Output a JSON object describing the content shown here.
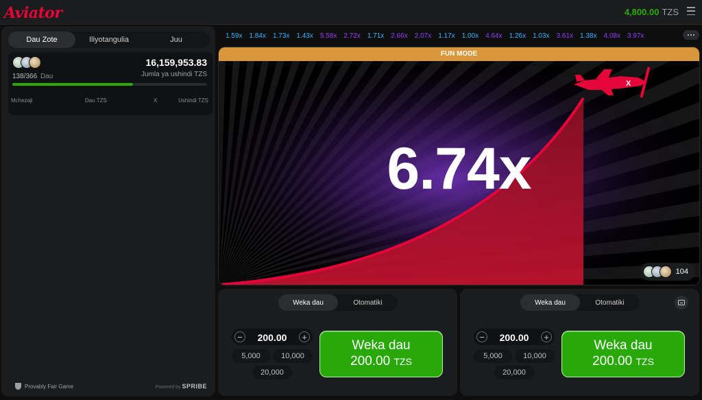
{
  "app": {
    "logo": "Aviator"
  },
  "header": {
    "balance": "4,800.00",
    "currency": "TZS"
  },
  "left_panel": {
    "tabs": [
      {
        "label": "Dau Zote",
        "active": true
      },
      {
        "label": "Iliyotangulia",
        "active": false
      },
      {
        "label": "Juu",
        "active": false
      }
    ],
    "bets_count": "138/366",
    "bets_label": "Dau",
    "total_win": "16,159,953.83",
    "total_win_label": "Jumla ya ushindi TZS",
    "progress": 0.62,
    "columns": [
      "Mchezaji",
      "Dau TZS",
      "X",
      "Ushindi TZS"
    ],
    "provably_fair": "Provably Fair Game",
    "powered_by": "Powered by",
    "provider": "SPRIBE"
  },
  "history": [
    {
      "value": "1.59x",
      "color": "#34b4ff"
    },
    {
      "value": "1.84x",
      "color": "#34b4ff"
    },
    {
      "value": "1.73x",
      "color": "#34b4ff"
    },
    {
      "value": "1.43x",
      "color": "#34b4ff"
    },
    {
      "value": "5.58x",
      "color": "#913ef8"
    },
    {
      "value": "2.72x",
      "color": "#913ef8"
    },
    {
      "value": "1.71x",
      "color": "#34b4ff"
    },
    {
      "value": "2.66x",
      "color": "#913ef8"
    },
    {
      "value": "2.07x",
      "color": "#913ef8"
    },
    {
      "value": "1.17x",
      "color": "#34b4ff"
    },
    {
      "value": "1.00x",
      "color": "#34b4ff"
    },
    {
      "value": "4.64x",
      "color": "#913ef8"
    },
    {
      "value": "1.26x",
      "color": "#34b4ff"
    },
    {
      "value": "1.03x",
      "color": "#34b4ff"
    },
    {
      "value": "3.61x",
      "color": "#913ef8"
    },
    {
      "value": "1.38x",
      "color": "#34b4ff"
    },
    {
      "value": "4.08x",
      "color": "#913ef8"
    },
    {
      "value": "3.97x",
      "color": "#913ef8"
    }
  ],
  "game": {
    "mode_banner": "FUN MODE",
    "multiplier": "6.74x",
    "players_online": "104",
    "accent": "#e50539",
    "banner_color": "#d9963a"
  },
  "bet_panels": [
    {
      "tabs": [
        {
          "label": "Weka dau",
          "active": true
        },
        {
          "label": "Otomatiki",
          "active": false
        }
      ],
      "stake": "200.00",
      "quick": [
        "5,000",
        "10,000",
        "20,000"
      ],
      "button_line1": "Weka dau",
      "button_amount": "200.00",
      "button_currency": "TZS"
    },
    {
      "tabs": [
        {
          "label": "Weka dau",
          "active": true
        },
        {
          "label": "Otomatiki",
          "active": false
        }
      ],
      "stake": "200.00",
      "quick": [
        "5,000",
        "10,000",
        "20,000"
      ],
      "button_line1": "Weka dau",
      "button_amount": "200.00",
      "button_currency": "TZS"
    }
  ]
}
